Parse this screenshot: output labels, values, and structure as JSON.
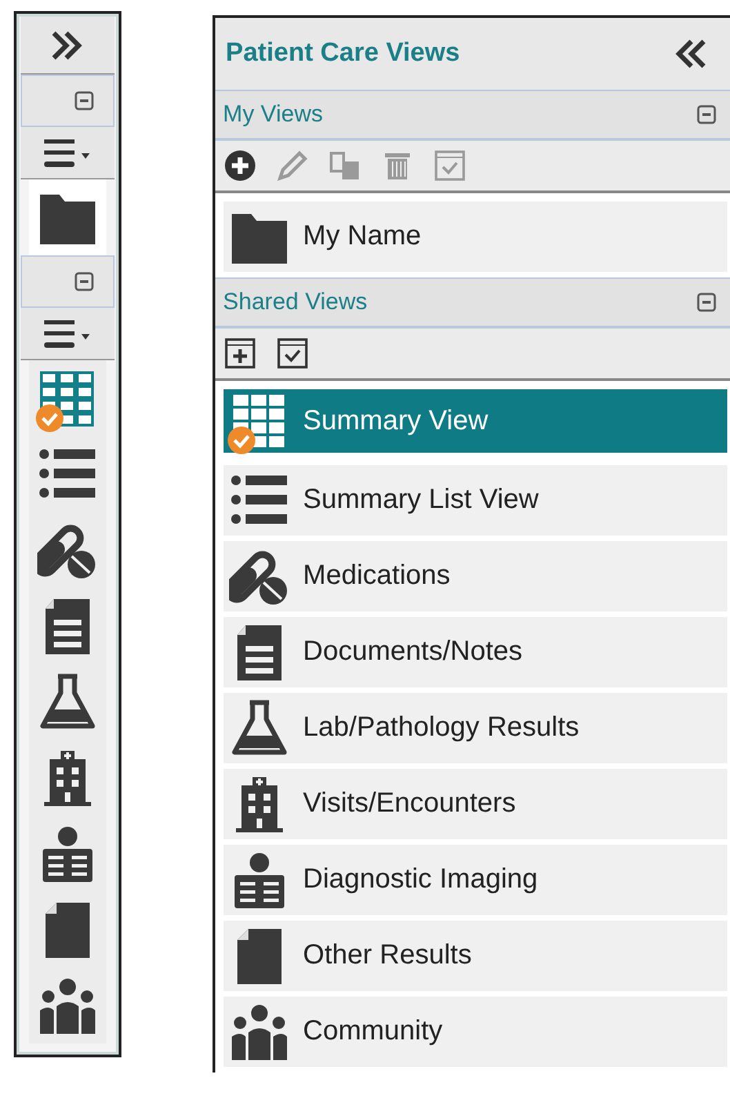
{
  "title": "Patient Care Views",
  "sections": [
    {
      "header": "My Views",
      "expanded": true,
      "toolbar": [
        {
          "kind": "add",
          "disabled": false
        },
        {
          "kind": "edit",
          "disabled": true
        },
        {
          "kind": "copy",
          "disabled": true
        },
        {
          "kind": "delete",
          "disabled": true
        },
        {
          "kind": "select",
          "disabled": true
        }
      ],
      "items": [
        {
          "label": "My Name",
          "kind": "folder",
          "selected": false,
          "default": false
        }
      ]
    },
    {
      "header": "Shared Views",
      "expanded": true,
      "toolbar": [
        {
          "kind": "add-window",
          "disabled": false
        },
        {
          "kind": "select",
          "disabled": false
        }
      ],
      "items": [
        {
          "label": "Summary View",
          "kind": "grid",
          "selected": true,
          "default": true
        },
        {
          "label": "Summary List View",
          "kind": "list",
          "selected": false,
          "default": false
        },
        {
          "label": "Medications",
          "kind": "pills",
          "selected": false,
          "default": false
        },
        {
          "label": "Documents/Notes",
          "kind": "document",
          "selected": false,
          "default": false
        },
        {
          "label": "Lab/Pathology Results",
          "kind": "flask",
          "selected": false,
          "default": false
        },
        {
          "label": "Visits/Encounters",
          "kind": "building",
          "selected": false,
          "default": false
        },
        {
          "label": "Diagnostic Imaging",
          "kind": "xray",
          "selected": false,
          "default": false
        },
        {
          "label": "Other Results",
          "kind": "file",
          "selected": false,
          "default": false
        },
        {
          "label": "Community",
          "kind": "community",
          "selected": false,
          "default": false
        }
      ]
    }
  ]
}
